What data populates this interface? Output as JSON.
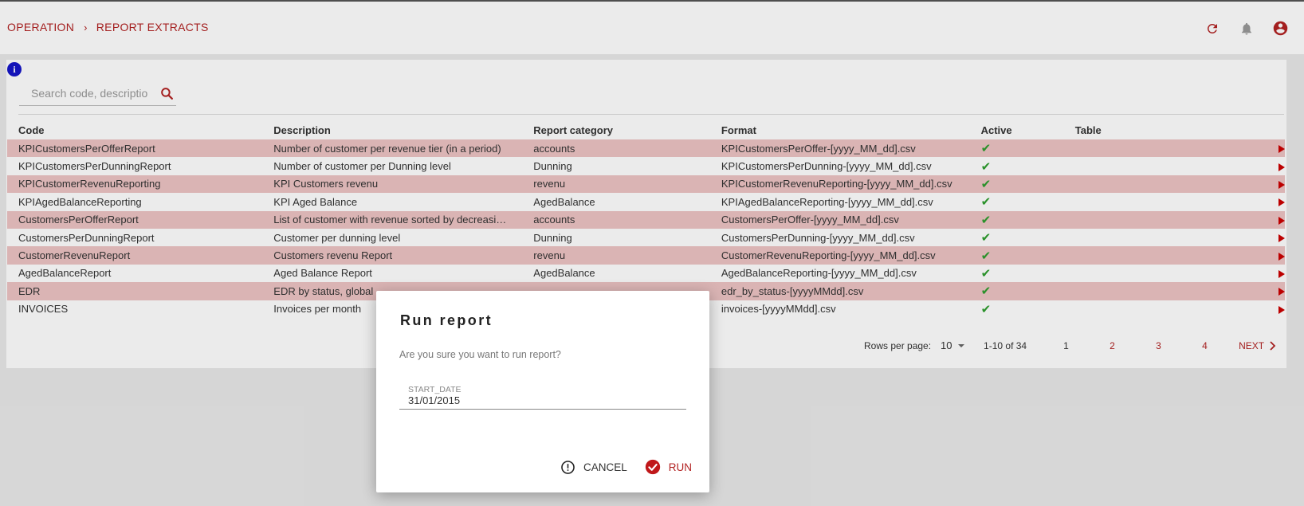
{
  "breadcrumb": {
    "parent": "OPERATION",
    "separator": "›",
    "current": "REPORT EXTRACTS"
  },
  "header_icons": [
    "refresh-icon",
    "bell-icon",
    "account-icon"
  ],
  "colors": {
    "accent": "#b22222",
    "row_highlight": "#edc4c4",
    "check": "#2e9e2e",
    "info": "#1515c8"
  },
  "search": {
    "placeholder": "Search code, description"
  },
  "table": {
    "headers": [
      "Code",
      "Description",
      "Report category",
      "Format",
      "Active",
      "Table"
    ],
    "rows": [
      {
        "code": "KPICustomersPerOfferReport",
        "description": "Number of customer per revenue tier (in a period)",
        "category": "accounts",
        "format": "KPICustomersPerOffer-[yyyy_MM_dd].csv"
      },
      {
        "code": "KPICustomersPerDunningReport",
        "description": "Number of customer per Dunning level",
        "category": "Dunning",
        "format": "KPICustomersPerDunning-[yyyy_MM_dd].csv"
      },
      {
        "code": "KPICustomerRevenuReporting",
        "description": "KPI Customers revenu",
        "category": "revenu",
        "format": "KPICustomerRevenuReporting-[yyyy_MM_dd].csv"
      },
      {
        "code": "KPIAgedBalanceReporting",
        "description": "KPI Aged Balance",
        "category": "AgedBalance",
        "format": "KPIAgedBalanceReporting-[yyyy_MM_dd].csv"
      },
      {
        "code": "CustomersPerOfferReport",
        "description": "List of customer with revenue sorted by decreasing...",
        "category": "accounts",
        "format": "CustomersPerOffer-[yyyy_MM_dd].csv"
      },
      {
        "code": "CustomersPerDunningReport",
        "description": "Customer per dunning level",
        "category": "Dunning",
        "format": "CustomersPerDunning-[yyyy_MM_dd].csv"
      },
      {
        "code": "CustomerRevenuReport",
        "description": "Customers revenu Report",
        "category": "revenu",
        "format": "CustomerRevenuReporting-[yyyy_MM_dd].csv"
      },
      {
        "code": "AgedBalanceReport",
        "description": "Aged Balance Report",
        "category": "AgedBalance",
        "format": "AgedBalanceReporting-[yyyy_MM_dd].csv"
      },
      {
        "code": "EDR",
        "description": "EDR by status, global",
        "category": "",
        "format": "edr_by_status-[yyyyMMdd].csv"
      },
      {
        "code": "INVOICES",
        "description": "Invoices per month",
        "category": "",
        "format": "invoices-[yyyyMMdd].csv"
      }
    ]
  },
  "pagination": {
    "rows_per_page_label": "Rows per page:",
    "rows_per_page": "10",
    "range": "1-10 of 34",
    "pages": [
      "1",
      "2",
      "3",
      "4"
    ],
    "next_label": "NEXT"
  },
  "dialog": {
    "title": "Run report",
    "message": "Are you sure you want to run report?",
    "field_label": "START_DATE",
    "field_value": "31/01/2015",
    "cancel_label": "CANCEL",
    "run_label": "RUN"
  }
}
